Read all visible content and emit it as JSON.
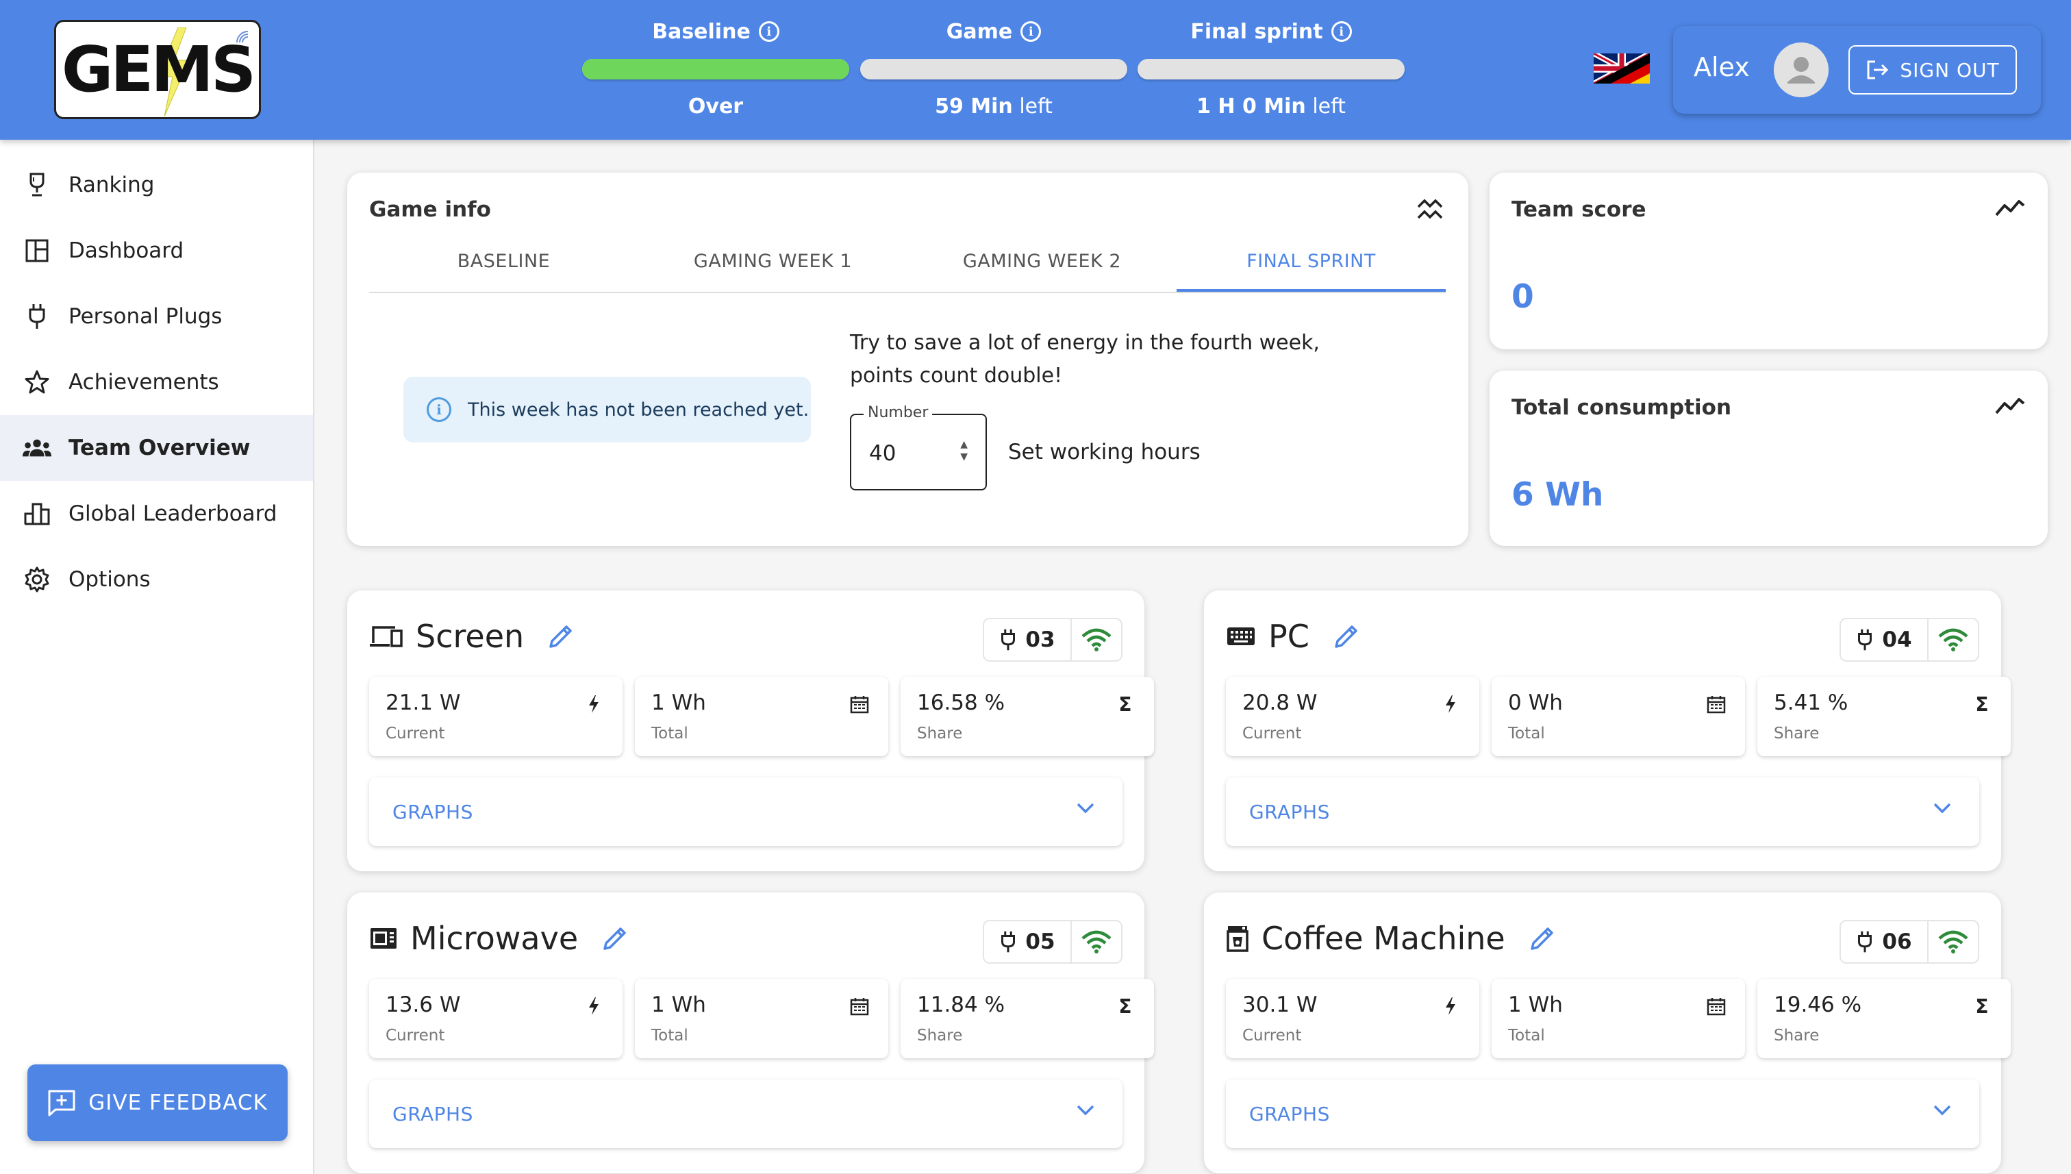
{
  "header": {
    "logo_text": "EMS",
    "logo_letter": "G",
    "progress": [
      {
        "label": "Baseline",
        "status_bold": "Over",
        "status_rest": "",
        "fill": 1.0
      },
      {
        "label": "Game",
        "status_bold": "59 Min",
        "status_rest": " left",
        "fill": 0.0
      },
      {
        "label": "Final sprint",
        "status_bold": "1 H 0 Min",
        "status_rest": " left",
        "fill": 0.0
      }
    ],
    "user_name": "Alex",
    "sign_out": "SIGN OUT"
  },
  "sidebar": {
    "items": [
      {
        "label": "Ranking",
        "icon": "trophy-icon"
      },
      {
        "label": "Dashboard",
        "icon": "dashboard-icon"
      },
      {
        "label": "Personal Plugs",
        "icon": "plug-icon"
      },
      {
        "label": "Achievements",
        "icon": "star-icon"
      },
      {
        "label": "Team Overview",
        "icon": "team-icon",
        "active": true
      },
      {
        "label": "Global Leaderboard",
        "icon": "leaderboard-icon"
      },
      {
        "label": "Options",
        "icon": "gear-icon"
      }
    ],
    "feedback": "GIVE FEEDBACK"
  },
  "game_info": {
    "title": "Game info",
    "tabs": [
      "BASELINE",
      "GAMING WEEK 1",
      "GAMING WEEK 2",
      "FINAL SPRINT"
    ],
    "active_tab": "FINAL SPRINT",
    "alert": "This week has not been reached yet.",
    "description_line1": "Try to save a lot of energy in the fourth week,",
    "description_line2": "points count double!",
    "number_legend": "Number",
    "number_value": "40",
    "number_label": "Set working hours"
  },
  "team_score": {
    "title": "Team score",
    "value": "0"
  },
  "total_consumption": {
    "title": "Total consumption",
    "value": "6 Wh"
  },
  "devices": [
    {
      "name": "Screen",
      "icon": "monitor-icon",
      "plug": "03",
      "current": "21.1 W",
      "current_label": "Current",
      "total": "1 Wh",
      "total_label": "Total",
      "share": "16.58 %",
      "share_label": "Share",
      "graphs": "GRAPHS"
    },
    {
      "name": "PC",
      "icon": "keyboard-icon",
      "plug": "04",
      "current": "20.8 W",
      "current_label": "Current",
      "total": "0 Wh",
      "total_label": "Total",
      "share": "5.41 %",
      "share_label": "Share",
      "graphs": "GRAPHS"
    },
    {
      "name": "Microwave",
      "icon": "microwave-icon",
      "plug": "05",
      "current": "13.6 W",
      "current_label": "Current",
      "total": "1 Wh",
      "total_label": "Total",
      "share": "11.84 %",
      "share_label": "Share",
      "graphs": "GRAPHS"
    },
    {
      "name": "Coffee Machine",
      "icon": "coffee-machine-icon",
      "plug": "06",
      "current": "30.1 W",
      "current_label": "Current",
      "total": "1 Wh",
      "total_label": "Total",
      "share": "19.46 %",
      "share_label": "Share",
      "graphs": "GRAPHS"
    }
  ],
  "colors": {
    "primary": "#4f86e6",
    "progress_green": "#6ed65a",
    "wifi_green": "#2e8b3a"
  }
}
